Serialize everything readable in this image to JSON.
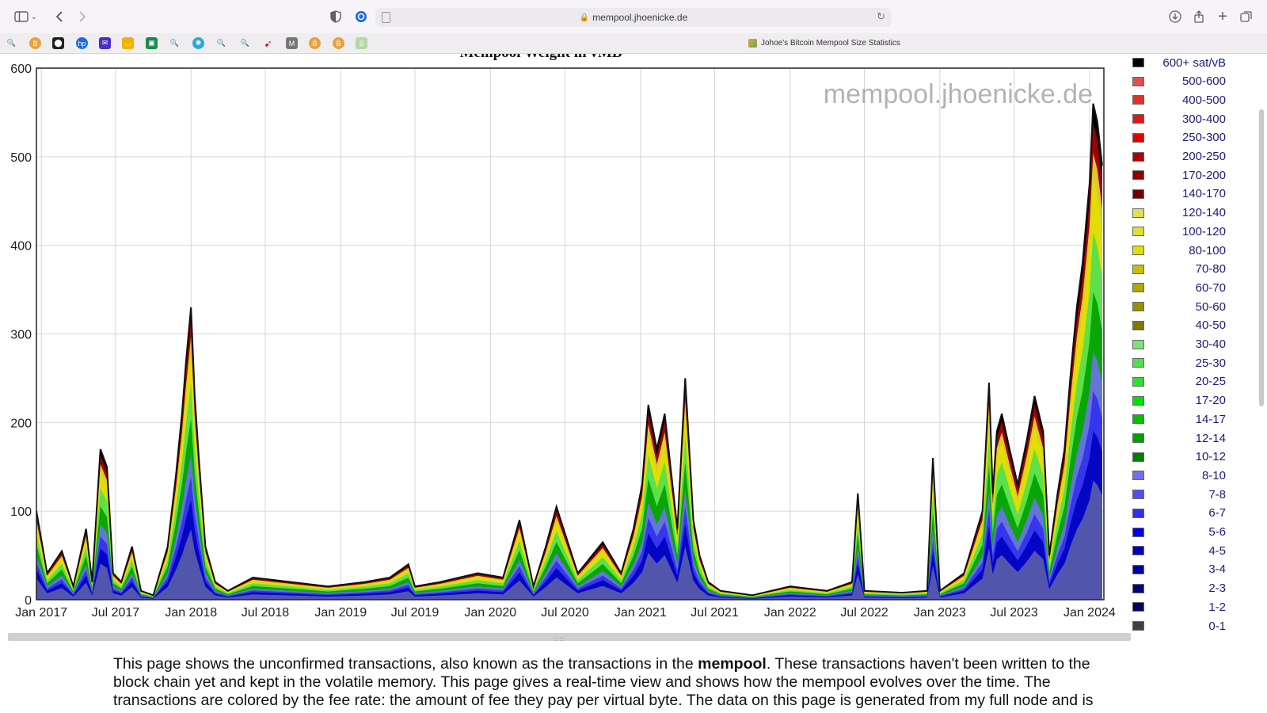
{
  "browser": {
    "address_text": "mempool.jhoenicke.de",
    "tab_title": "Johoe's Bitcoin Mempool Size Statistics"
  },
  "chart_data": {
    "type": "area",
    "title": "Mempool Weight in vMB",
    "watermark": "mempool.jhoenicke.de",
    "ylim": [
      0,
      600
    ],
    "yticks": [
      "0",
      "100",
      "200",
      "300",
      "400",
      "500",
      "600"
    ],
    "x_ticks": [
      "Jan 2017",
      "Jul 2017",
      "Jan 2018",
      "Jul 2018",
      "Jan 2019",
      "Jul 2019",
      "Jan 2020",
      "Jul 2020",
      "Jan 2021",
      "Jul 2021",
      "Jan 2022",
      "Jul 2022",
      "Jan 2023",
      "Jul 2023",
      "Jan 2024"
    ],
    "xlim": [
      "2016-12-20",
      "2024-02-05"
    ],
    "grid": true,
    "legend_position": "right",
    "series_order_bottom_to_top": [
      "0-1",
      "1-2",
      "2-3",
      "3-4",
      "4-5",
      "5-6",
      "6-7",
      "7-8",
      "8-10",
      "10-12",
      "12-14",
      "14-17",
      "17-20",
      "20-25",
      "25-30",
      "30-40",
      "40-50",
      "50-60",
      "60-70",
      "70-80",
      "80-100",
      "100-120",
      "120-140",
      "140-170",
      "170-200",
      "200-250",
      "250-300",
      "300-400",
      "400-500",
      "500-600",
      "600+ sat/vB"
    ],
    "total_envelope": {
      "x": [
        "2016-12-20",
        "2017-01-15",
        "2017-02-20",
        "2017-03-20",
        "2017-04-20",
        "2017-05-05",
        "2017-05-25",
        "2017-06-10",
        "2017-06-25",
        "2017-07-15",
        "2017-08-10",
        "2017-09-01",
        "2017-10-01",
        "2017-11-05",
        "2017-11-25",
        "2017-12-10",
        "2017-12-20",
        "2018-01-01",
        "2018-01-10",
        "2018-01-20",
        "2018-02-05",
        "2018-03-01",
        "2018-04-01",
        "2018-06-01",
        "2018-09-01",
        "2018-12-01",
        "2019-03-01",
        "2019-05-01",
        "2019-06-15",
        "2019-07-01",
        "2019-09-01",
        "2019-12-01",
        "2020-02-01",
        "2020-03-12",
        "2020-04-15",
        "2020-05-15",
        "2020-06-10",
        "2020-08-01",
        "2020-10-01",
        "2020-11-15",
        "2020-12-15",
        "2021-01-05",
        "2021-01-20",
        "2021-02-10",
        "2021-03-01",
        "2021-04-01",
        "2021-04-20",
        "2021-05-10",
        "2021-05-25",
        "2021-06-15",
        "2021-07-15",
        "2021-10-01",
        "2022-01-01",
        "2022-04-01",
        "2022-06-01",
        "2022-06-15",
        "2022-07-01",
        "2022-10-01",
        "2022-12-01",
        "2022-12-15",
        "2023-01-01",
        "2023-03-01",
        "2023-04-15",
        "2023-05-01",
        "2023-05-10",
        "2023-05-20",
        "2023-06-01",
        "2023-06-20",
        "2023-07-10",
        "2023-08-01",
        "2023-08-20",
        "2023-09-10",
        "2023-09-25",
        "2023-10-15",
        "2023-11-01",
        "2023-11-15",
        "2023-12-01",
        "2023-12-15",
        "2024-01-01",
        "2024-01-10",
        "2024-01-20",
        "2024-02-01"
      ],
      "y": [
        100,
        30,
        55,
        15,
        80,
        20,
        170,
        150,
        30,
        20,
        60,
        10,
        5,
        60,
        140,
        210,
        270,
        330,
        230,
        160,
        60,
        20,
        10,
        25,
        20,
        15,
        20,
        25,
        40,
        15,
        20,
        30,
        25,
        90,
        15,
        60,
        105,
        30,
        65,
        30,
        80,
        130,
        220,
        170,
        210,
        80,
        250,
        90,
        50,
        20,
        10,
        5,
        15,
        10,
        20,
        120,
        10,
        8,
        10,
        160,
        10,
        30,
        100,
        245,
        120,
        190,
        210,
        170,
        130,
        180,
        230,
        190,
        50,
        120,
        170,
        250,
        330,
        380,
        470,
        560,
        540,
        490
      ]
    },
    "legend": [
      {
        "label": "600+ sat/vB",
        "color": "#000000"
      },
      {
        "label": "500-600",
        "color": "#e05050"
      },
      {
        "label": "400-500",
        "color": "#e03030"
      },
      {
        "label": "300-400",
        "color": "#e01818"
      },
      {
        "label": "250-300",
        "color": "#e00000"
      },
      {
        "label": "200-250",
        "color": "#b00000"
      },
      {
        "label": "170-200",
        "color": "#900000"
      },
      {
        "label": "140-170",
        "color": "#700000"
      },
      {
        "label": "120-140",
        "color": "#e0e050"
      },
      {
        "label": "100-120",
        "color": "#e0e030"
      },
      {
        "label": "80-100",
        "color": "#e0e000"
      },
      {
        "label": "70-80",
        "color": "#c8c000"
      },
      {
        "label": "60-70",
        "color": "#b0a800"
      },
      {
        "label": "50-60",
        "color": "#989000"
      },
      {
        "label": "40-50",
        "color": "#807800"
      },
      {
        "label": "30-40",
        "color": "#80e080"
      },
      {
        "label": "25-30",
        "color": "#50e050"
      },
      {
        "label": "20-25",
        "color": "#30e030"
      },
      {
        "label": "17-20",
        "color": "#00e000"
      },
      {
        "label": "14-17",
        "color": "#00c000"
      },
      {
        "label": "12-14",
        "color": "#00a000"
      },
      {
        "label": "10-12",
        "color": "#008000"
      },
      {
        "label": "8-10",
        "color": "#7070f0"
      },
      {
        "label": "7-8",
        "color": "#5050f0"
      },
      {
        "label": "6-7",
        "color": "#3030f0"
      },
      {
        "label": "5-6",
        "color": "#0000f0"
      },
      {
        "label": "4-5",
        "color": "#0000c0"
      },
      {
        "label": "3-4",
        "color": "#0000a0"
      },
      {
        "label": "2-3",
        "color": "#000080"
      },
      {
        "label": "1-2",
        "color": "#000060"
      },
      {
        "label": "0-1",
        "color": "#404040"
      }
    ]
  },
  "description": {
    "t1": "This page shows the unconfirmed transactions, also known as the transactions in the ",
    "bold": "mempool",
    "t2": ". These transactions haven't been written to the block chain yet and kept in the volatile memory. This page gives a real-time view and shows how the mempool evolves over the time. The transactions are colored by the fee rate: the amount of fee they pay per virtual byte. The data on this page is generated from my full node and is"
  }
}
